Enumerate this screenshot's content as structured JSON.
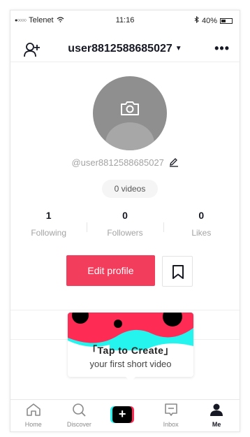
{
  "status_bar": {
    "carrier": "Telenet",
    "time": "11:16",
    "battery": "40%"
  },
  "header": {
    "username": "user8812588685027",
    "more": "•••"
  },
  "profile": {
    "handle": "@user8812588685027",
    "videos_label": "0 videos",
    "stats": [
      {
        "value": "1",
        "label": "Following"
      },
      {
        "value": "0",
        "label": "Followers"
      },
      {
        "value": "0",
        "label": "Likes"
      }
    ],
    "edit_profile_label": "Edit profile"
  },
  "create_card": {
    "title": "「Tap to Create」",
    "subtitle": "your first short video",
    "colors": {
      "cyan": "#25F4EE",
      "red": "#FE2C55",
      "black": "#000000"
    }
  },
  "tabbar": {
    "items": [
      {
        "label": "Home",
        "icon": "home-icon"
      },
      {
        "label": "Discover",
        "icon": "search-icon"
      },
      {
        "label": "",
        "icon": "plus-icon"
      },
      {
        "label": "Inbox",
        "icon": "inbox-icon"
      },
      {
        "label": "Me",
        "icon": "person-icon"
      }
    ]
  },
  "colors": {
    "accent": "#F23E5C",
    "text_primary": "#161823",
    "text_secondary": "#A3A3A3"
  }
}
